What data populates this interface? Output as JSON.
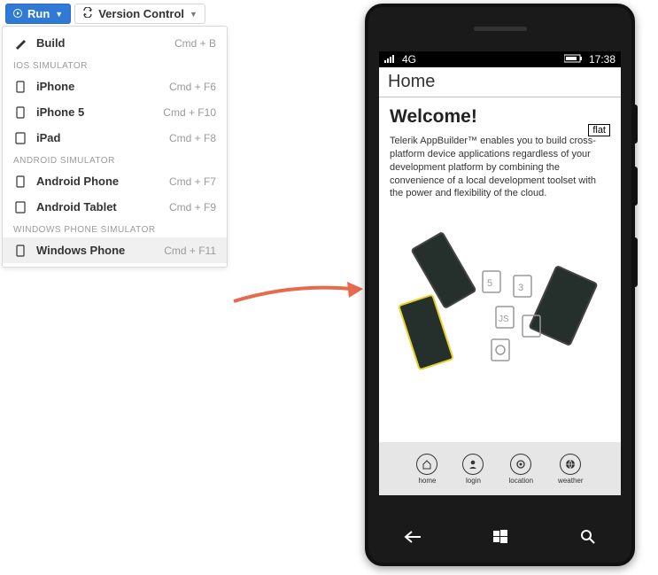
{
  "toolbar": {
    "run_label": "Run",
    "vc_label": "Version Control"
  },
  "dropdown": {
    "build": {
      "label": "Build",
      "shortcut": "Cmd + B"
    },
    "h_ios": "IOS SIMULATOR",
    "iphone": {
      "label": "iPhone",
      "shortcut": "Cmd + F6"
    },
    "iphone5": {
      "label": "iPhone 5",
      "shortcut": "Cmd + F10"
    },
    "ipad": {
      "label": "iPad",
      "shortcut": "Cmd + F8"
    },
    "h_android": "ANDROID SIMULATOR",
    "aph": {
      "label": "Android Phone",
      "shortcut": "Cmd + F7"
    },
    "atab": {
      "label": "Android Tablet",
      "shortcut": "Cmd + F9"
    },
    "h_wp": "WINDOWS PHONE SIMULATOR",
    "wp": {
      "label": "Windows Phone",
      "shortcut": "Cmd + F11"
    }
  },
  "status": {
    "network": "4G",
    "time": "17:38"
  },
  "app": {
    "title": "Home",
    "heading": "Welcome!",
    "flat": "flat",
    "body": "Telerik AppBuilder™ enables you to build cross-platform device applications regardless of your development platform by combining the convenience of a local development toolset with the power and flexibility of the cloud."
  },
  "tabs": {
    "home": "home",
    "login": "login",
    "location": "location",
    "weather": "weather"
  }
}
